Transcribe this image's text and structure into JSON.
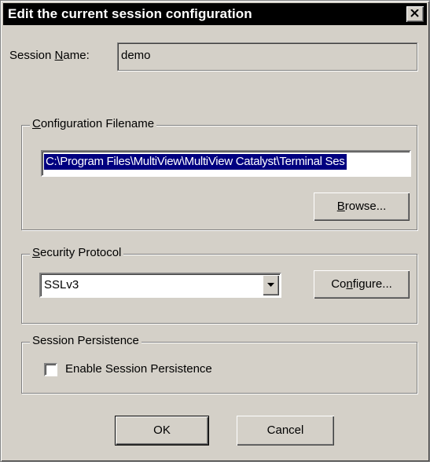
{
  "window": {
    "title": "Edit the current session configuration",
    "close_icon": "close-icon"
  },
  "session": {
    "label_prefix": "Session ",
    "label_accel": "N",
    "label_suffix": "ame:",
    "value": "demo"
  },
  "config_file": {
    "group_accel": "C",
    "group_rest": "onfiguration Filename",
    "path": "C:\\Program Files\\MultiView\\MultiView Catalyst\\Terminal Ses",
    "browse_accel": "B",
    "browse_rest": "rowse..."
  },
  "security": {
    "group_accel": "S",
    "group_rest": "ecurity Protocol",
    "selected": "SSLv3",
    "configure_pre": "Co",
    "configure_accel": "n",
    "configure_post": "figure..."
  },
  "persistence": {
    "group_title": "Session Persistence",
    "checkbox_label": "Enable Session Persistence",
    "checked": false
  },
  "footer": {
    "ok_label": "OK",
    "cancel_label": "Cancel"
  },
  "colors": {
    "dialog_bg": "#d4d0c8",
    "titlebar_bg": "#000000",
    "selection_bg": "#000080"
  }
}
